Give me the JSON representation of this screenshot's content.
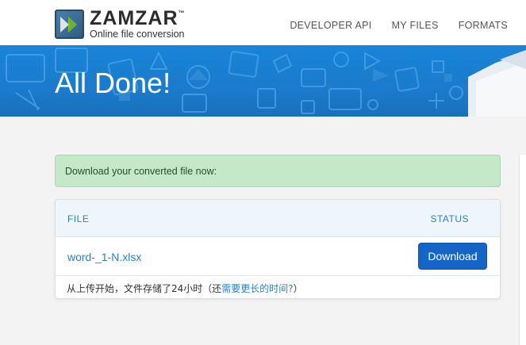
{
  "brand": {
    "name": "ZAMZAR",
    "trademark": "™",
    "tagline": "Online file conversion"
  },
  "nav": {
    "items": [
      "DEVELOPER API",
      "MY FILES",
      "FORMATS"
    ]
  },
  "banner": {
    "title": "All Done!"
  },
  "alert": {
    "message": "Download your converted file now:"
  },
  "table": {
    "headers": {
      "file": "FILE",
      "status": "STATUS"
    },
    "rows": [
      {
        "file_name": "word-_1-N.xlsx",
        "action_label": "Download"
      }
    ]
  },
  "note": {
    "prefix": "从上传开始，文件存储了24小时（还",
    "link": "需要更长的时间?",
    "suffix": "）"
  },
  "colors": {
    "banner_blue": "#1a84d6",
    "link_blue": "#2f7fc6",
    "button_blue": "#1565c8",
    "alert_green": "#c4e8c8"
  },
  "icons": [
    "zamzar-logo-icon",
    "banner-pattern"
  ]
}
